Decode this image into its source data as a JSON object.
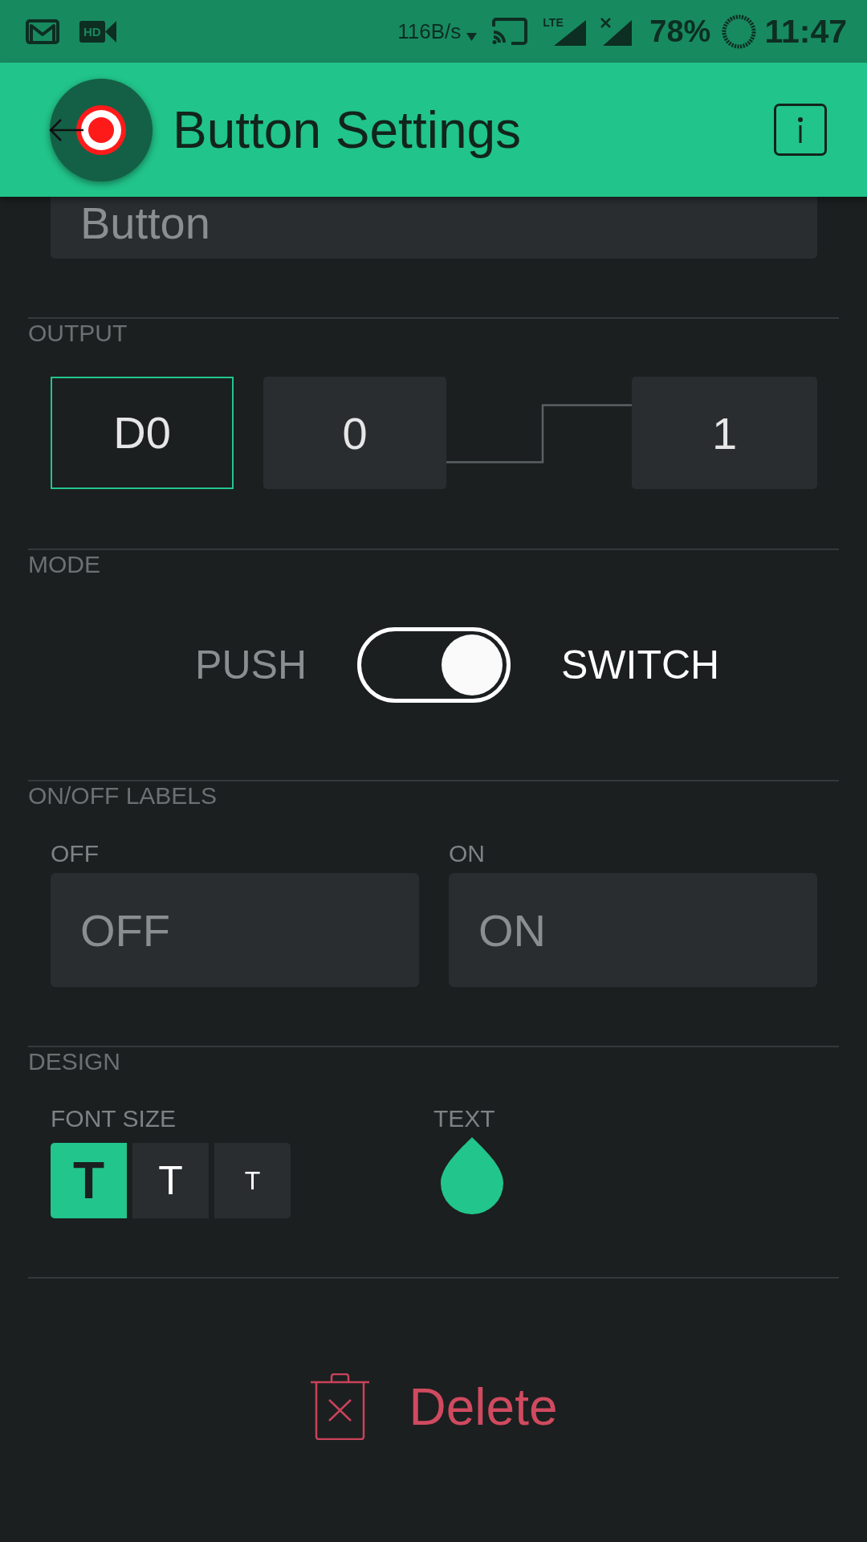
{
  "status_bar": {
    "video_badge": "HD",
    "net_speed": "116B/s",
    "network": "LTE",
    "battery": "78%",
    "time": "11:47"
  },
  "header": {
    "title": "Button Settings"
  },
  "name_field": {
    "placeholder": "Button"
  },
  "output": {
    "heading": "OUTPUT",
    "pin": "D0",
    "low": "0",
    "high": "1"
  },
  "mode": {
    "heading": "MODE",
    "options": [
      {
        "label": "PUSH",
        "selected": false
      },
      {
        "label": "SWITCH",
        "selected": true
      }
    ]
  },
  "on_off_labels": {
    "heading": "ON/OFF LABELS",
    "fields": [
      {
        "label": "OFF",
        "placeholder": "OFF"
      },
      {
        "label": "ON",
        "placeholder": "ON"
      }
    ]
  },
  "design": {
    "heading": "DESIGN",
    "font_size": {
      "label": "FONT SIZE",
      "options": [
        {
          "glyph": "T",
          "kind": "large",
          "selected": true
        },
        {
          "glyph": "T",
          "kind": "medium",
          "selected": false
        },
        {
          "glyph": "T",
          "kind": "small",
          "selected": false
        }
      ]
    },
    "text_color": {
      "label": "TEXT",
      "color": "#22c58b"
    }
  },
  "delete": {
    "label": "Delete"
  }
}
